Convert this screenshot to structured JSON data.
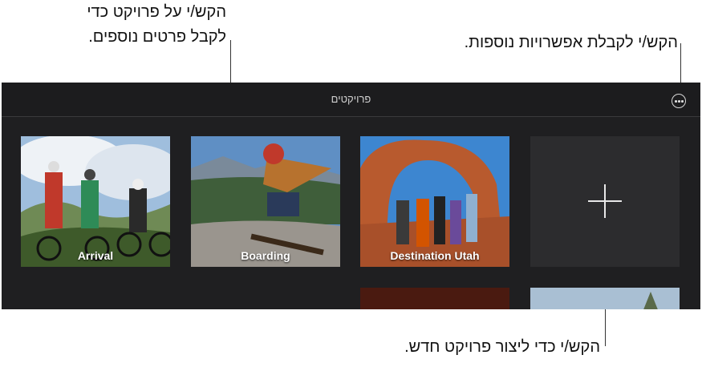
{
  "callouts": {
    "project_line1": "הקש/י על פרויקט כדי",
    "project_line2": "לקבל פרטים נוספים.",
    "more_options": "הקש/י לקבלת אפשרויות נוספות.",
    "new_project": "הקש/י כדי ליצור פרויקט חדש."
  },
  "header": {
    "title": "פרויקטים",
    "more_icon": "ellipsis-circle-icon"
  },
  "projects": [
    {
      "label": "Arrival"
    },
    {
      "label": "Boarding"
    },
    {
      "label": "Destination Utah"
    }
  ],
  "new_project_icon": "plus-icon"
}
